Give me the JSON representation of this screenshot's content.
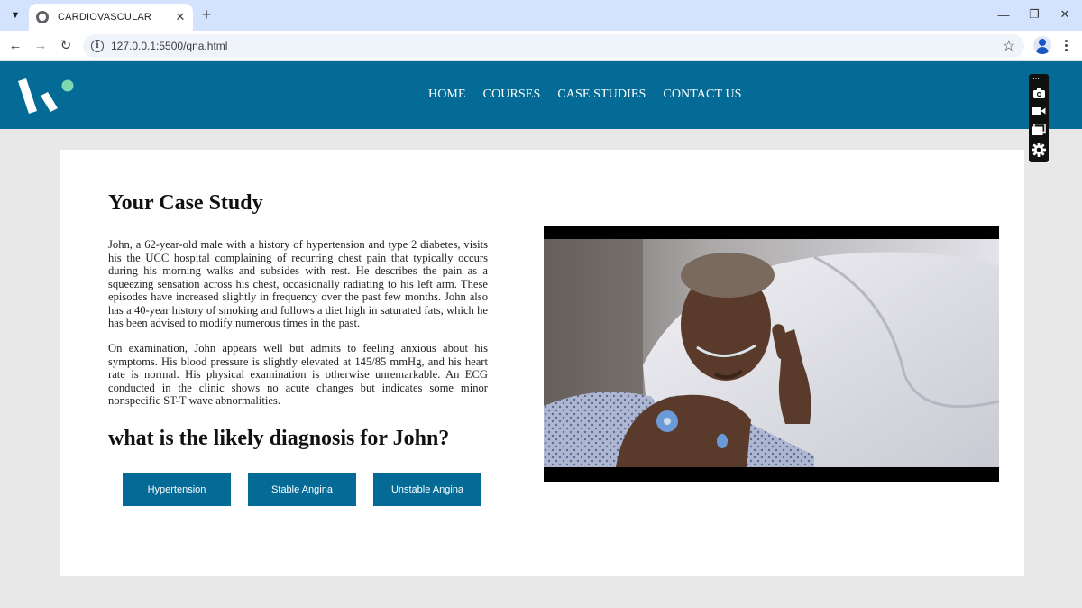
{
  "browser": {
    "tab_title": "CARDIOVASCULAR",
    "url": "127.0.0.1:5500/qna.html",
    "icons": [
      "tab-search-icon",
      "globe-favicon-icon",
      "close-icon",
      "new-tab-icon",
      "minimize-icon",
      "restore-icon",
      "window-close-icon",
      "back-icon",
      "forward-icon",
      "reload-icon",
      "site-info-icon",
      "bookmark-star-icon",
      "profile-icon",
      "menu-kebab-icon"
    ]
  },
  "header": {
    "nav": [
      "HOME",
      "COURSES",
      "CASE STUDIES",
      "CONTACT US"
    ],
    "colors": {
      "header_bg": "#046b96",
      "logo_dot": "#7ed9b2"
    }
  },
  "capture_toolbar": {
    "icons": [
      "camera-icon",
      "video-camera-icon",
      "window-capture-icon",
      "settings-gear-icon"
    ]
  },
  "case": {
    "title": "Your Case Study",
    "paragraph1": "John, a 62-year-old male with a history of hypertension and type 2 diabetes, visits his the UCC hospital complaining of recurring chest pain that typically occurs during his morning walks and subsides with rest. He describes the pain as a squeezing sensation across his chest, occasionally radiating to his left arm. These episodes have increased slightly in frequency over the past few months. John also has a 40-year history of smoking and follows a diet high in saturated fats, which he has been advised to modify numerous times in the past.",
    "paragraph2": "On examination, John appears well but admits to feeling anxious about his symptoms. His blood pressure is slightly elevated at 145/85 mmHg, and his heart rate is normal. His physical examination is otherwise unremarkable. An ECG conducted in the clinic shows no acute changes but indicates some minor nonspecific ST-T wave abnormalities.",
    "question": "what is the likely diagnosis for John?",
    "answers": [
      "Hypertension",
      "Stable Angina",
      "Unstable Angina"
    ],
    "colors": {
      "button_bg": "#046b96",
      "button_text": "#ffffff"
    }
  },
  "video": {
    "icon": "patient-video-still"
  }
}
